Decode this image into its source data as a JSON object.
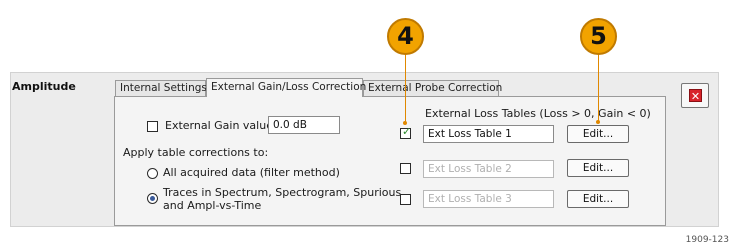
{
  "section_label": "Amplitude",
  "tabs": [
    {
      "label": "Internal Settings",
      "active": false
    },
    {
      "label": "External Gain/Loss Correction",
      "active": true
    },
    {
      "label": "External Probe Correction",
      "active": false
    }
  ],
  "gain": {
    "checkbox_label": "External Gain value:",
    "checked": false,
    "value": "0.0 dB"
  },
  "apply": {
    "label": "Apply table corrections to:",
    "options": [
      {
        "line1": "All acquired data (filter method)",
        "line2": "",
        "selected": false
      },
      {
        "line1": "Traces in Spectrum, Spectrogram, Spurious",
        "line2": "and Ampl-vs-Time",
        "selected": true
      }
    ]
  },
  "loss_tables": {
    "header": "External Loss Tables (Loss > 0, Gain < 0)",
    "rows": [
      {
        "name": "Ext Loss Table 1",
        "checked": true,
        "enabled": true,
        "edit_label": "Edit..."
      },
      {
        "name": "Ext Loss Table 2",
        "checked": false,
        "enabled": false,
        "edit_label": "Edit..."
      },
      {
        "name": "Ext Loss Table 3",
        "checked": false,
        "enabled": false,
        "edit_label": "Edit..."
      }
    ]
  },
  "callouts": [
    "4",
    "5"
  ],
  "close_icon": "close-icon",
  "accent_colors": {
    "callout": "#f2a300",
    "close": "#d8232a",
    "check": "#2e8b2e"
  },
  "figure_code": "1909-123"
}
